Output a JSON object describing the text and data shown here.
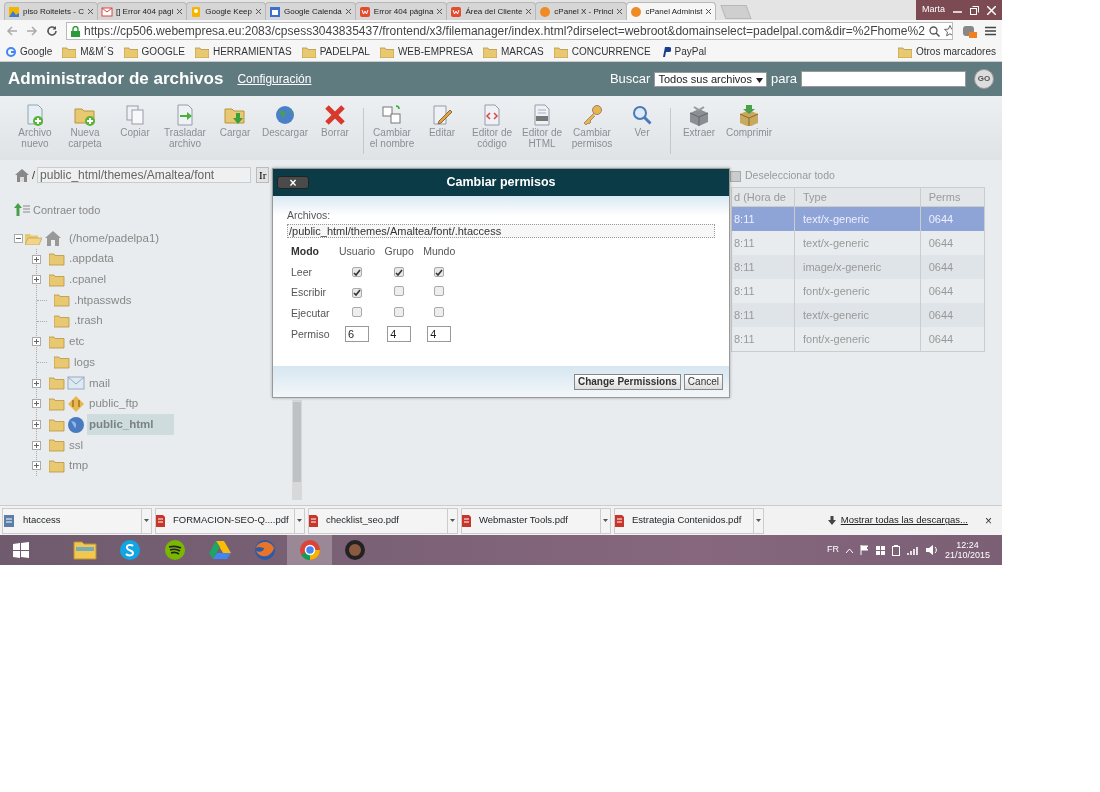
{
  "browser": {
    "tabs": [
      {
        "label": "piso Roitelets - C",
        "selected": false
      },
      {
        "label": "[] Error 404 pági",
        "selected": false
      },
      {
        "label": "Google Keep",
        "selected": false
      },
      {
        "label": "Google Calenda",
        "selected": false
      },
      {
        "label": "Error 404 página",
        "selected": false
      },
      {
        "label": "Área del Cliente",
        "selected": false
      },
      {
        "label": "cPanel X - Princi",
        "selected": false
      },
      {
        "label": "cPanel Administ",
        "selected": true
      }
    ],
    "user": "Marta",
    "url": "https://cp506.webempresa.eu:2083/cpsess3043835437/frontend/x3/filemanager/index.html?dirselect=webroot&domainselect=padelpal.com&dir=%2Fhome%2",
    "bookmarks": [
      "Google",
      "M&M´S",
      "GOOGLE",
      "HERRAMIENTAS",
      "PADELPAL",
      "WEB-EMPRESA",
      "MARCAS",
      "CONCURRENCE",
      "PayPal"
    ],
    "other_bookmarks": "Otros marcadores"
  },
  "header": {
    "title": "Administrador de archivos",
    "settings_link": "Configuración",
    "search_label": "Buscar",
    "search_scope": "Todos sus archivos",
    "for_label": "para",
    "go": "GO"
  },
  "toolbar": {
    "groups": [
      [
        {
          "lines": [
            "Archivo",
            "nuevo"
          ]
        },
        {
          "lines": [
            "Nueva",
            "carpeta"
          ]
        },
        {
          "lines": [
            "Copiar"
          ]
        },
        {
          "lines": [
            "Trasladar",
            "archivo"
          ]
        },
        {
          "lines": [
            "Cargar"
          ]
        },
        {
          "lines": [
            "Descargar"
          ]
        },
        {
          "lines": [
            "Borrar"
          ]
        }
      ],
      [
        {
          "lines": [
            "Cambiar",
            "el nombre"
          ]
        },
        {
          "lines": [
            "Editar"
          ]
        },
        {
          "lines": [
            "Editor de",
            "código"
          ]
        },
        {
          "lines": [
            "Editor de",
            "HTML"
          ]
        },
        {
          "lines": [
            "Cambiar",
            "permisos"
          ]
        },
        {
          "lines": [
            "Ver"
          ]
        }
      ],
      [
        {
          "lines": [
            "Extraer"
          ]
        },
        {
          "lines": [
            "Comprimir"
          ]
        }
      ]
    ]
  },
  "path_bar": {
    "separator": "/",
    "value": "public_html/themes/Amaltea/font",
    "go": "Ir"
  },
  "collapse_all": "Contraer todo",
  "tree": {
    "label": "(/home/padelpa1)",
    "expanded": true,
    "children": [
      {
        "label": ".appdata",
        "kind": "folder",
        "expandable": true,
        "selected": false
      },
      {
        "label": ".cpanel",
        "kind": "folder",
        "expandable": true,
        "selected": false
      },
      {
        "label": ".htpasswds",
        "kind": "folder",
        "expandable": false,
        "selected": false
      },
      {
        "label": ".trash",
        "kind": "folder",
        "expandable": false,
        "selected": false
      },
      {
        "label": "etc",
        "kind": "folder",
        "expandable": true,
        "selected": false
      },
      {
        "label": "logs",
        "kind": "folder",
        "expandable": false,
        "selected": false
      },
      {
        "label": "mail",
        "kind": "mail",
        "expandable": true,
        "selected": false
      },
      {
        "label": "public_ftp",
        "kind": "ftp",
        "expandable": true,
        "selected": false
      },
      {
        "label": "public_html",
        "kind": "web",
        "expandable": true,
        "selected": true
      },
      {
        "label": "ssl",
        "kind": "folder",
        "expandable": true,
        "selected": false
      },
      {
        "label": "tmp",
        "kind": "folder",
        "expandable": true,
        "selected": false
      }
    ]
  },
  "file_list": {
    "deselect_all": "Deseleccionar todo",
    "columns": [
      "d (Hora de",
      "Type",
      "Perms"
    ],
    "rows": [
      {
        "cells": [
          "8:11",
          "text/x-generic",
          "0644"
        ],
        "selected": true
      },
      {
        "cells": [
          "8:11",
          "text/x-generic",
          "0644"
        ],
        "selected": false
      },
      {
        "cells": [
          "8:11",
          "image/x-generic",
          "0644"
        ],
        "selected": false
      },
      {
        "cells": [
          "8:11",
          "font/x-generic",
          "0644"
        ],
        "selected": false
      },
      {
        "cells": [
          "8:11",
          "text/x-generic",
          "0644"
        ],
        "selected": false
      },
      {
        "cells": [
          "8:11",
          "font/x-generic",
          "0644"
        ],
        "selected": false
      }
    ]
  },
  "dialog": {
    "close": "×",
    "title": "Cambiar permisos",
    "files_label": "Archivos:",
    "file_path": "/public_html/themes/Amaltea/font/.htaccess",
    "mode_label": "Modo",
    "columns": [
      "Usuario",
      "Grupo",
      "Mundo"
    ],
    "rows": [
      {
        "label": "Leer",
        "cells": [
          {
            "checked": true
          },
          {
            "checked": true
          },
          {
            "checked": true
          }
        ]
      },
      {
        "label": "Escribir",
        "cells": [
          {
            "checked": true
          },
          {
            "checked": false
          },
          {
            "checked": false
          }
        ]
      },
      {
        "label": "Ejecutar",
        "cells": [
          {
            "checked": false
          },
          {
            "checked": false
          },
          {
            "checked": false
          }
        ]
      }
    ],
    "permission_label": "Permiso",
    "permission_values": [
      "6",
      "4",
      "4"
    ],
    "buttons": [
      "Change Permissions",
      "Cancel"
    ]
  },
  "downloads": {
    "items": [
      {
        "name": "htaccess",
        "kind": "file"
      },
      {
        "name": "FORMACION-SEO-Q....pdf",
        "kind": "pdf"
      },
      {
        "name": "checklist_seo.pdf",
        "kind": "pdf"
      },
      {
        "name": "Webmaster Tools.pdf",
        "kind": "pdf"
      },
      {
        "name": "Estrategia Contenidos.pdf",
        "kind": "pdf"
      }
    ],
    "show_all": "Mostrar todas las descargas...",
    "close": "×"
  },
  "taskbar": {
    "apps": [
      {
        "selected": false
      },
      {
        "selected": false
      },
      {
        "selected": false
      },
      {
        "selected": false
      },
      {
        "selected": false
      },
      {
        "selected": true
      },
      {
        "selected": false
      }
    ],
    "language": "FR",
    "time": "12:24",
    "date": "21/10/2015"
  }
}
